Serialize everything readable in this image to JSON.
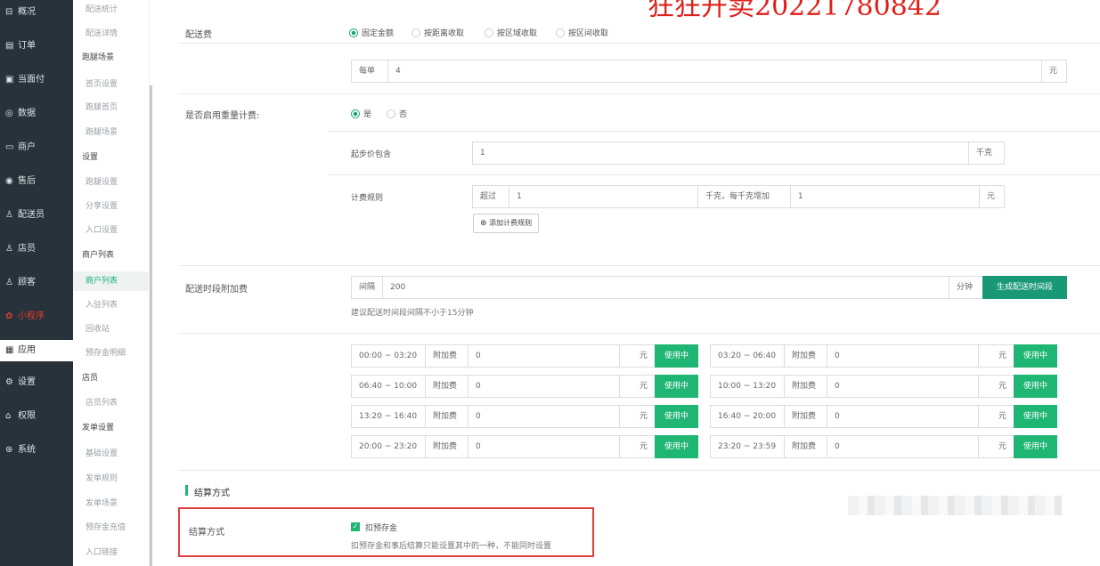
{
  "watermark": "狂狂开卖20221780842",
  "leftnav": [
    {
      "icon": "⊟",
      "label": "概况",
      "name": "overview"
    },
    {
      "icon": "▤",
      "label": "订单",
      "name": "orders"
    },
    {
      "icon": "▣",
      "label": "当面付",
      "name": "face-pay"
    },
    {
      "icon": "◎",
      "label": "数据",
      "name": "data"
    },
    {
      "icon": "▭",
      "label": "商户",
      "name": "merchants"
    },
    {
      "icon": "◉",
      "label": "售后",
      "name": "after-sales"
    },
    {
      "icon": "♙",
      "label": "配送员",
      "name": "couriers"
    },
    {
      "icon": "♙",
      "label": "店员",
      "name": "clerks"
    },
    {
      "icon": "♙",
      "label": "顾客",
      "name": "customers"
    },
    {
      "icon": "✿",
      "label": "小程序",
      "name": "mini-program"
    },
    {
      "icon": "▦",
      "label": "应用",
      "name": "apps"
    },
    {
      "icon": "⚙",
      "label": "设置",
      "name": "settings"
    },
    {
      "icon": "⌂",
      "label": "权限",
      "name": "permissions"
    },
    {
      "icon": "⊛",
      "label": "系统",
      "name": "system"
    }
  ],
  "subnav": [
    {
      "label": "配送统计",
      "kind": "i"
    },
    {
      "label": "配送详情",
      "kind": "i"
    },
    {
      "label": "跑腿场景",
      "kind": "g"
    },
    {
      "label": "首页设置",
      "kind": "i"
    },
    {
      "label": "跑腿首页",
      "kind": "i"
    },
    {
      "label": "跑腿场景",
      "kind": "i"
    },
    {
      "label": "设置",
      "kind": "g"
    },
    {
      "label": "跑腿设置",
      "kind": "i"
    },
    {
      "label": "分享设置",
      "kind": "i"
    },
    {
      "label": "入口设置",
      "kind": "i"
    },
    {
      "label": "商户列表",
      "kind": "g"
    },
    {
      "label": "商户列表",
      "kind": "i"
    },
    {
      "label": "入驻列表",
      "kind": "i"
    },
    {
      "label": "回收站",
      "kind": "i"
    },
    {
      "label": "预存金明细",
      "kind": "i"
    },
    {
      "label": "店员",
      "kind": "g"
    },
    {
      "label": "店员列表",
      "kind": "i"
    },
    {
      "label": "发单设置",
      "kind": "g"
    },
    {
      "label": "基础设置",
      "kind": "i"
    },
    {
      "label": "发单规则",
      "kind": "i"
    },
    {
      "label": "发单场景",
      "kind": "i"
    },
    {
      "label": "预存金充值",
      "kind": "i"
    },
    {
      "label": "入口链接",
      "kind": "i"
    }
  ],
  "fee": {
    "label": "配送费",
    "options": [
      "固定金额",
      "按距离收取",
      "按区域收取",
      "按区间收取"
    ],
    "per_label": "每单",
    "per_value": "4",
    "unit": "元"
  },
  "weight": {
    "label": "是否启用重量计费:",
    "yes": "是",
    "no": "否",
    "start_label": "起步价包含",
    "start_value": "1",
    "start_unit": "千克",
    "rule_label": "计费规则",
    "over": "超过",
    "over_value": "1",
    "mid": "千克，每千克增加",
    "add_value": "1",
    "add_unit": "元",
    "add_rule_btn": "添加计费规则"
  },
  "slots": {
    "label": "配送时段附加费",
    "interval_label": "间隔",
    "interval_value": "200",
    "interval_unit": "分钟",
    "generate_btn": "生成配送时间段",
    "hint": "建议配送时间段间隔不小于15分钟",
    "fee_label": "附加费",
    "unit": "元",
    "status": "使用中",
    "rows": [
      {
        "time": "00:00 ~ 03:20",
        "fee": "0"
      },
      {
        "time": "03:20 ~ 06:40",
        "fee": "0"
      },
      {
        "time": "06:40 ~ 10:00",
        "fee": "0"
      },
      {
        "time": "10:00 ~ 13:20",
        "fee": "0"
      },
      {
        "time": "13:20 ~ 16:40",
        "fee": "0"
      },
      {
        "time": "16:40 ~ 20:00",
        "fee": "0"
      },
      {
        "time": "20:00 ~ 23:20",
        "fee": "0"
      },
      {
        "time": "23:20 ~ 23:59",
        "fee": "0"
      }
    ]
  },
  "settle": {
    "section_title": "结算方式",
    "label": "结算方式",
    "checkbox_label": "扣预存金",
    "hint": "扣预存金和事后结算只能设置其中的一种，不能同时设置"
  }
}
